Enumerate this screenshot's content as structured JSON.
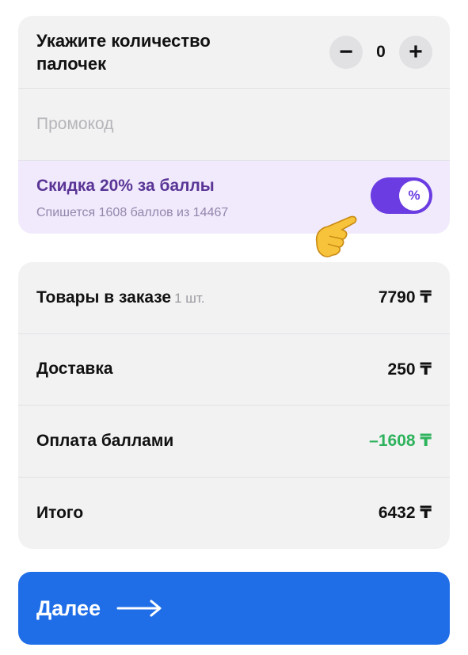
{
  "quantity": {
    "label": "Укажите количество палочек",
    "value": "0",
    "minus_symbol": "−",
    "plus_symbol": "+"
  },
  "promo": {
    "placeholder": "Промокод"
  },
  "discount": {
    "title": "Скидка 20% за баллы",
    "subtitle": "Спишется 1608 баллов из 14467",
    "toggle_on": true,
    "toggle_symbol": "%",
    "accent_color": "#6a3ce2"
  },
  "summary": {
    "rows": [
      {
        "label": "Товары в заказе",
        "qty": "1 шт.",
        "value": "7790 ₸"
      },
      {
        "label": "Доставка",
        "value": "250 ₸"
      },
      {
        "label": "Оплата баллами",
        "value": "–1608 ₸",
        "color": "#2eb35c"
      },
      {
        "label": "Итого",
        "value": "6432 ₸"
      }
    ]
  },
  "next_button": {
    "label": "Далее",
    "color": "#1f6ee8"
  },
  "icons": [
    "minus-icon",
    "plus-icon",
    "percent-icon",
    "pointing-hand-icon",
    "arrow-right-icon"
  ]
}
